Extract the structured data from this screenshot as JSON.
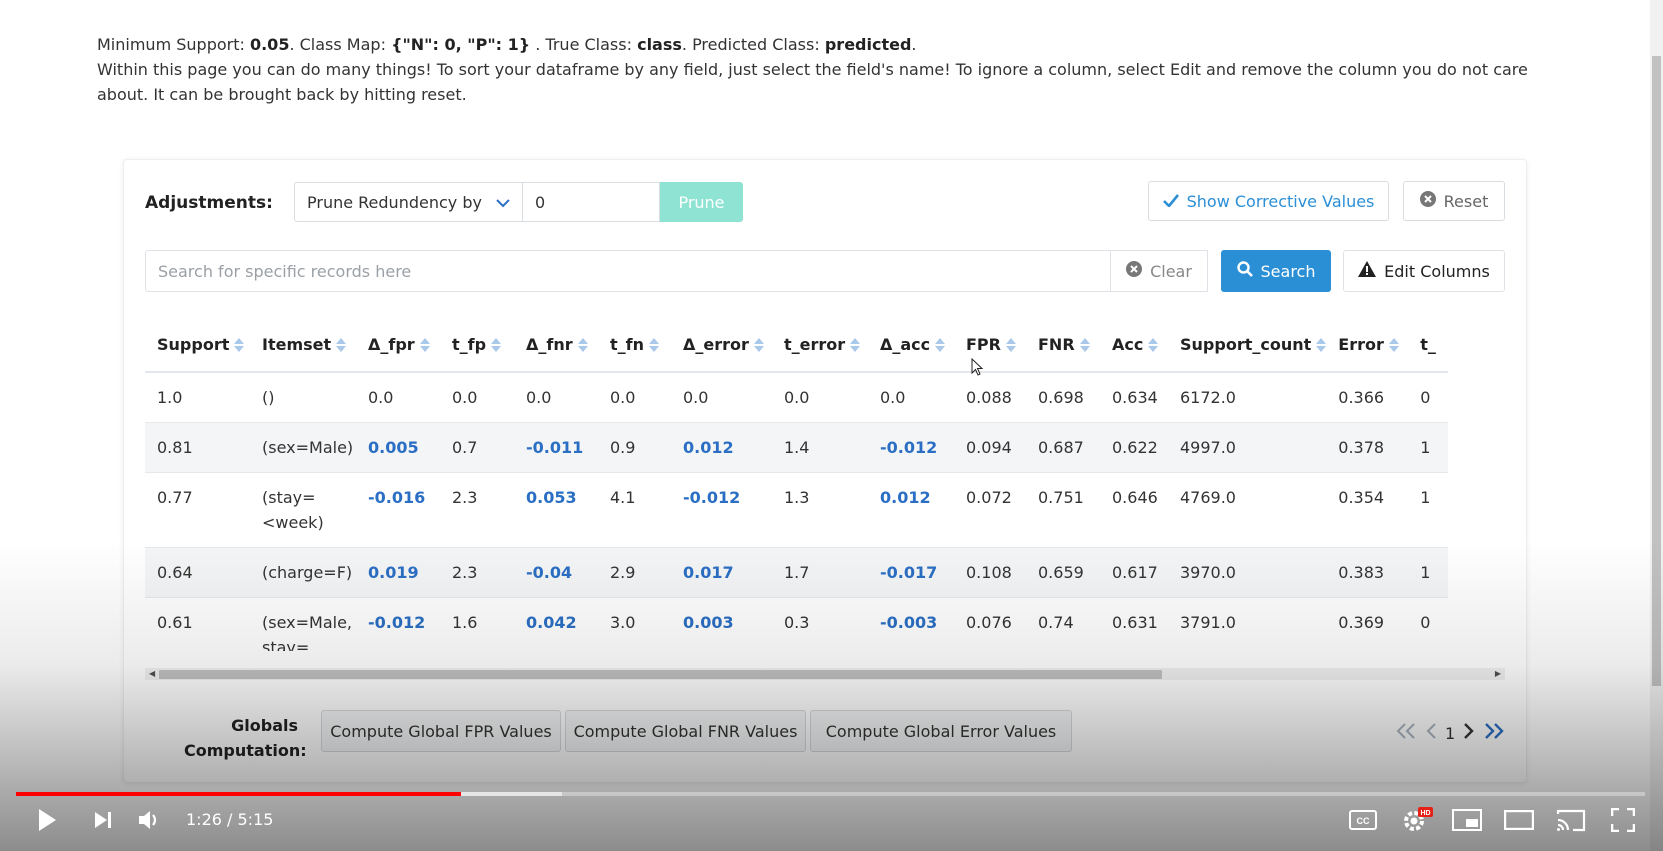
{
  "intro": {
    "label_min_support": "Minimum Support:",
    "min_support": "0.05",
    "label_class_map": ". Class Map:",
    "class_map": "{\"N\": 0, \"P\": 1}",
    "label_true_class": ". True Class:",
    "true_class": "class",
    "label_pred_class": ". Predicted Class:",
    "pred_class": "predicted",
    "end_dot": ".",
    "description": "Within this page you can do many things! To sort your dataframe by any field, just select the field's name! To ignore a column, select Edit and remove the column you do not care about. It can be brought back by hitting reset."
  },
  "adjustments": {
    "label": "Adjustments:",
    "prune_select": "Prune Redundency by",
    "prune_value": "0",
    "prune_button": "Prune",
    "show_corrective": "Show Corrective Values",
    "reset": "Reset"
  },
  "search": {
    "placeholder": "Search for specific records here",
    "clear": "Clear",
    "search": "Search",
    "edit_columns": "Edit Columns"
  },
  "table": {
    "headers": [
      "Support",
      "Itemset",
      "Δ_fpr",
      "t_fp",
      "Δ_fnr",
      "t_fn",
      "Δ_error",
      "t_error",
      "Δ_acc",
      "FPR",
      "FNR",
      "Acc",
      "Support_count",
      "Error",
      "t_"
    ],
    "rows": [
      [
        "1.0",
        "()",
        "0.0",
        "0.0",
        "0.0",
        "0.0",
        "0.0",
        "0.0",
        "0.0",
        "0.088",
        "0.698",
        "0.634",
        "6172.0",
        "0.366",
        "0"
      ],
      [
        "0.81",
        "(sex=Male)",
        "0.005",
        "0.7",
        "-0.011",
        "0.9",
        "0.012",
        "1.4",
        "-0.012",
        "0.094",
        "0.687",
        "0.622",
        "4997.0",
        "0.378",
        "1"
      ],
      [
        "0.77",
        "(stay=\n<week)",
        "-0.016",
        "2.3",
        "0.053",
        "4.1",
        "-0.012",
        "1.3",
        "0.012",
        "0.072",
        "0.751",
        "0.646",
        "4769.0",
        "0.354",
        "1"
      ],
      [
        "0.64",
        "(charge=F)",
        "0.019",
        "2.3",
        "-0.04",
        "2.9",
        "0.017",
        "1.7",
        "-0.017",
        "0.108",
        "0.659",
        "0.617",
        "3970.0",
        "0.383",
        "1"
      ],
      [
        "0.61",
        "(sex=Male,\nstay=\n<week)",
        "-0.012",
        "1.6",
        "0.042",
        "3.0",
        "0.003",
        "0.3",
        "-0.003",
        "0.076",
        "0.74",
        "0.631",
        "3791.0",
        "0.369",
        "0"
      ]
    ]
  },
  "globals": {
    "label": "Globals Computation:",
    "fpr": "Compute Global FPR Values",
    "fnr": "Compute Global FNR Values",
    "error": "Compute Global Error Values"
  },
  "pager": {
    "page": "1"
  },
  "video": {
    "time": "1:26 / 5:15",
    "played_fraction": 0.273,
    "buffered_fraction": 0.335
  }
}
